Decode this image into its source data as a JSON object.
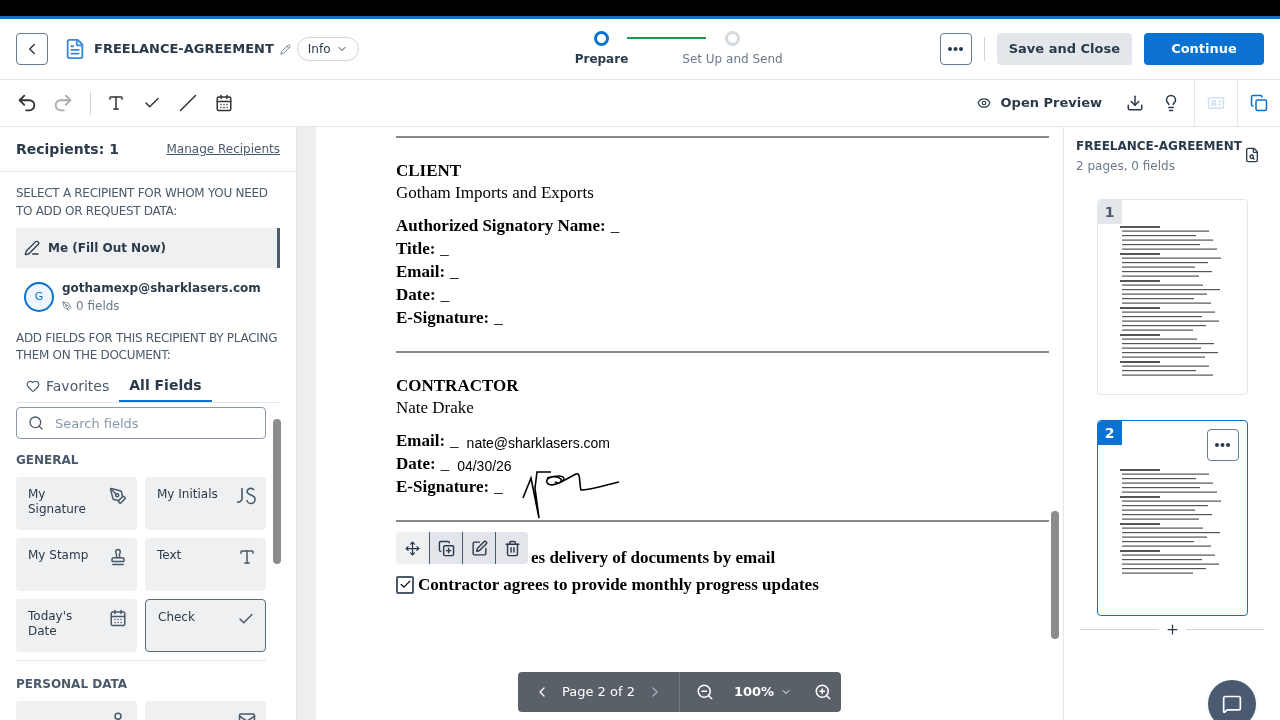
{
  "header": {
    "doc_title": "FREELANCE-AGREEMENT",
    "info_label": "Info",
    "steps": [
      {
        "label": "Prepare",
        "selected": true
      },
      {
        "label": "Set Up and Send",
        "selected": false
      }
    ],
    "save_label": "Save and Close",
    "continue_label": "Continue"
  },
  "toolbar": {
    "preview_label": "Open Preview"
  },
  "sidebar": {
    "recipients_count": "Recipients: 1",
    "manage_link": "Manage Recipients",
    "select_prompt": "SELECT A RECIPIENT FOR WHOM YOU NEED TO ADD OR REQUEST DATA:",
    "recipients": [
      {
        "kind": "self",
        "name": "Me (Fill Out Now)",
        "selected": true
      },
      {
        "kind": "contact",
        "initial": "G",
        "name": "gothamexp@sharklasers.com",
        "fields": "0 fields",
        "selected": false
      }
    ],
    "add_prompt": "ADD FIELDS FOR THIS RECIPIENT BY PLACING THEM ON THE DOCUMENT:",
    "tabs": [
      {
        "label": "Favorites",
        "selected": false
      },
      {
        "label": "All Fields",
        "selected": true
      }
    ],
    "search": {
      "placeholder": "Search fields"
    },
    "groups": [
      {
        "title": "GENERAL",
        "fields": [
          {
            "label": "My Signature",
            "kind": "signature",
            "selected": false
          },
          {
            "label": "My Initials",
            "kind": "initials",
            "selected": false
          },
          {
            "label": "My Stamp",
            "kind": "stamp",
            "selected": false
          },
          {
            "label": "Text",
            "kind": "text",
            "selected": false
          },
          {
            "label": "Today's Date",
            "kind": "date",
            "selected": false
          },
          {
            "label": "Check",
            "kind": "check",
            "selected": true
          }
        ]
      },
      {
        "title": "PERSONAL DATA",
        "fields": [
          {
            "kind": "person"
          },
          {
            "kind": "email"
          }
        ]
      }
    ]
  },
  "document": {
    "sections": [
      {
        "heading": "CLIENT",
        "name": "Gotham Imports and Exports",
        "signed": false,
        "fields": [
          {
            "label": "Authorized Signatory Name:",
            "blank": "_"
          },
          {
            "label": "Title:",
            "blank": "_"
          },
          {
            "label": "Email:",
            "blank": "_"
          },
          {
            "label": "Date:",
            "blank": "_"
          },
          {
            "label": "E-Signature:",
            "blank": "_"
          }
        ]
      },
      {
        "heading": "CONTRACTOR",
        "name": "Nate Drake",
        "signed": true,
        "fields": [
          {
            "label": "Email:",
            "blank": "_",
            "value": "nate@sharklasers.com"
          },
          {
            "label": "Date:",
            "blank": "_",
            "value": "04/30/26"
          },
          {
            "label": "E-Signature:",
            "blank": "_"
          }
        ]
      }
    ],
    "checks": [
      {
        "text": "es delivery of documents by email"
      },
      {
        "text": "Contractor agrees to provide monthly progress updates",
        "checked": true
      }
    ],
    "pager": {
      "page_label": "Page 2 of 2",
      "zoom": "100%"
    }
  },
  "pages_panel": {
    "title": "FREELANCE-AGREEMENT",
    "subtitle": "2 pages, 0 fields",
    "pages": [
      {
        "number": "1",
        "selected": false
      },
      {
        "number": "2",
        "selected": true
      }
    ]
  }
}
